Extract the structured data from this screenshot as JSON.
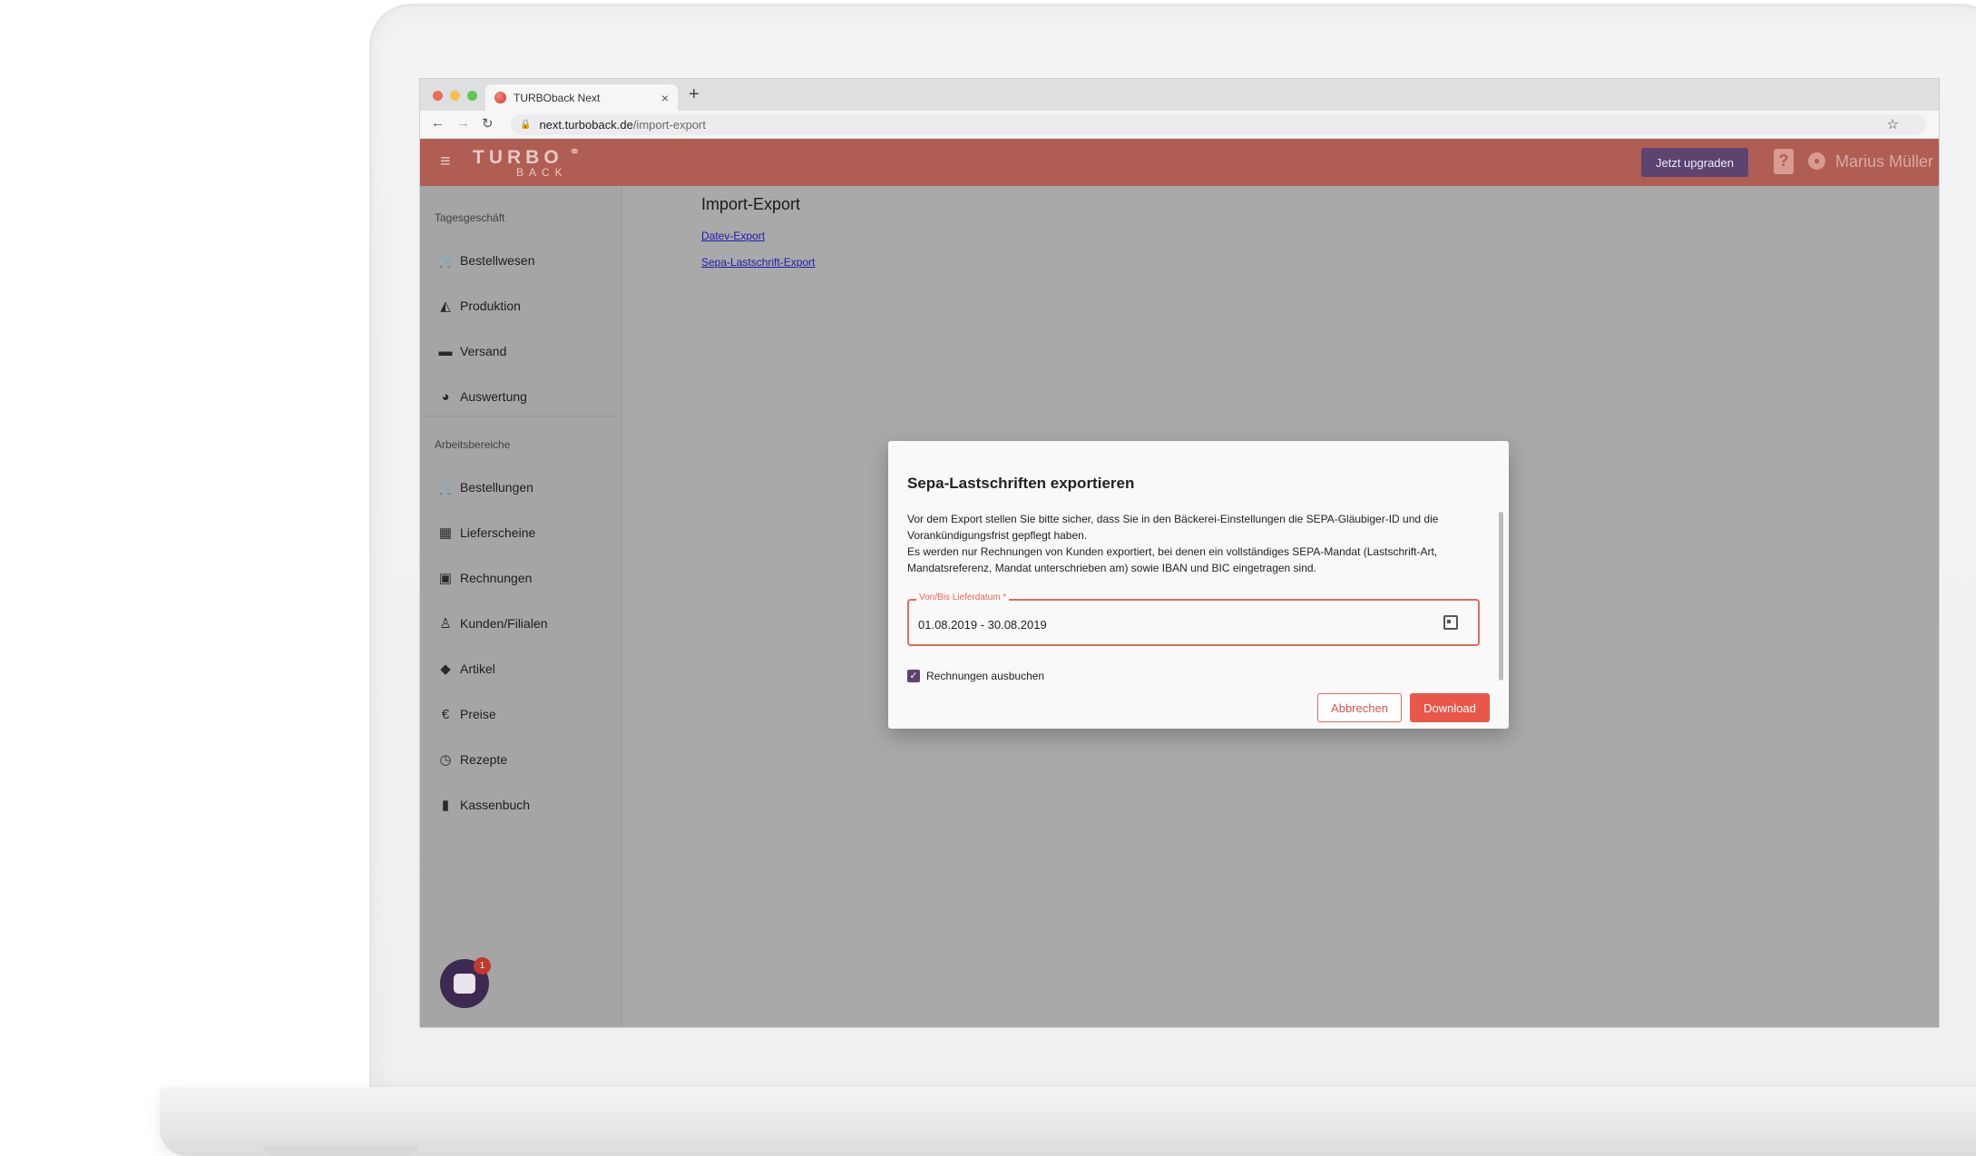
{
  "browser": {
    "tab_title": "TURBOback Next",
    "tab_close": "×",
    "new_tab": "+",
    "url_host": "next.turboback.de",
    "url_path": "/import-export"
  },
  "header": {
    "logo_top": "TURBO",
    "logo_bottom": "BACK",
    "upgrade_label": "Jetzt upgraden",
    "help_label": "?",
    "user_name": "Marius Müller"
  },
  "sidebar": {
    "section1_label": "Tagesgeschäft",
    "section1_items": [
      {
        "label": "Bestellwesen",
        "icon": "cart-icon"
      },
      {
        "label": "Produktion",
        "icon": "production-icon"
      },
      {
        "label": "Versand",
        "icon": "truck-icon"
      },
      {
        "label": "Auswertung",
        "icon": "pie-chart-icon"
      }
    ],
    "section2_label": "Arbeitsbereiche",
    "section2_items": [
      {
        "label": "Bestellungen",
        "icon": "cart-icon"
      },
      {
        "label": "Lieferscheine",
        "icon": "calendar-icon"
      },
      {
        "label": "Rechnungen",
        "icon": "wallet-icon"
      },
      {
        "label": "Kunden/Filialen",
        "icon": "person-icon"
      },
      {
        "label": "Artikel",
        "icon": "tag-icon"
      },
      {
        "label": "Preise",
        "icon": "euro-icon"
      },
      {
        "label": "Rezepte",
        "icon": "clock-icon"
      },
      {
        "label": "Kassenbuch",
        "icon": "book-icon"
      }
    ],
    "chat_badge": "1"
  },
  "main": {
    "title": "Import-Export",
    "links": [
      "Datev-Export",
      "Sepa-Lastschrift-Export"
    ]
  },
  "dialog": {
    "title": "Sepa-Lastschriften exportieren",
    "text1": "Vor dem Export stellen Sie bitte sicher, dass Sie in den Bäckerei-Einstellungen die SEPA-Gläubiger-ID und die Vorankündigungsfrist gepflegt haben.",
    "text2": "Es werden nur Rechnungen von Kunden exportiert, bei denen ein vollständiges SEPA-Mandat (Lastschrift-Art, Mandatsreferenz, Mandat unterschrieben am) sowie IBAN und BIC eingetragen sind.",
    "field_label": "Von/Bis Lieferdatum *",
    "field_value": "01.08.2019 - 30.08.2019",
    "checkbox_label": "Rechnungen ausbuchen",
    "checkbox_checked": true,
    "cancel_label": "Abbrechen",
    "download_label": "Download"
  }
}
